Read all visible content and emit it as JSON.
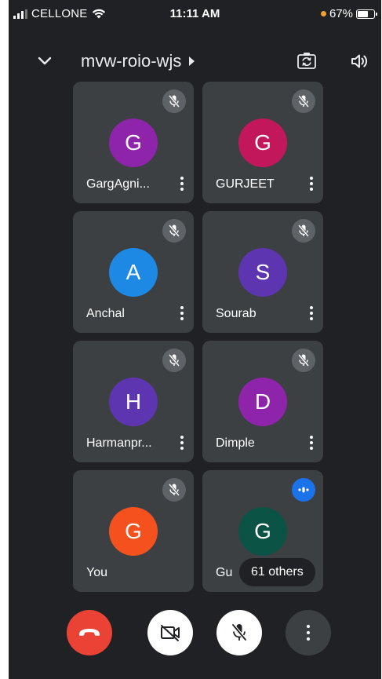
{
  "status_bar": {
    "carrier": "CELLONE",
    "time": "11:11 AM",
    "battery": "67%",
    "battery_level": 0.67,
    "signal_bars": 3,
    "signal_bars_total": 4
  },
  "top_bar": {
    "meeting_code": "mvw-roio-wjs",
    "icons": [
      "chevron-down-icon",
      "switch-camera-icon",
      "speaker-icon"
    ]
  },
  "participants": [
    {
      "initial": "G",
      "name": "GargAgni...",
      "color": "#8e24aa",
      "muted": true
    },
    {
      "initial": "G",
      "name": "GURJEET",
      "color": "#c2185b",
      "muted": true
    },
    {
      "initial": "A",
      "name": "Anchal",
      "color": "#1e88e5",
      "muted": true
    },
    {
      "initial": "S",
      "name": "Sourab",
      "color": "#5e35b1",
      "muted": true
    },
    {
      "initial": "H",
      "name": "Harmanpr...",
      "color": "#5e35b1",
      "muted": true
    },
    {
      "initial": "D",
      "name": "Dimple",
      "color": "#8e24aa",
      "muted": true
    },
    {
      "initial": "G",
      "name": "You",
      "color": "#f4511e",
      "muted": true
    },
    {
      "initial": "G",
      "name": "Gu",
      "color": "#0b5345",
      "muted": false,
      "speaking": true
    }
  ],
  "others_label": "61 others",
  "controls": {
    "end_call_color": "#ea4335",
    "icons": [
      "end-call-icon",
      "camera-off-icon",
      "mic-off-icon",
      "more-options-icon"
    ]
  }
}
